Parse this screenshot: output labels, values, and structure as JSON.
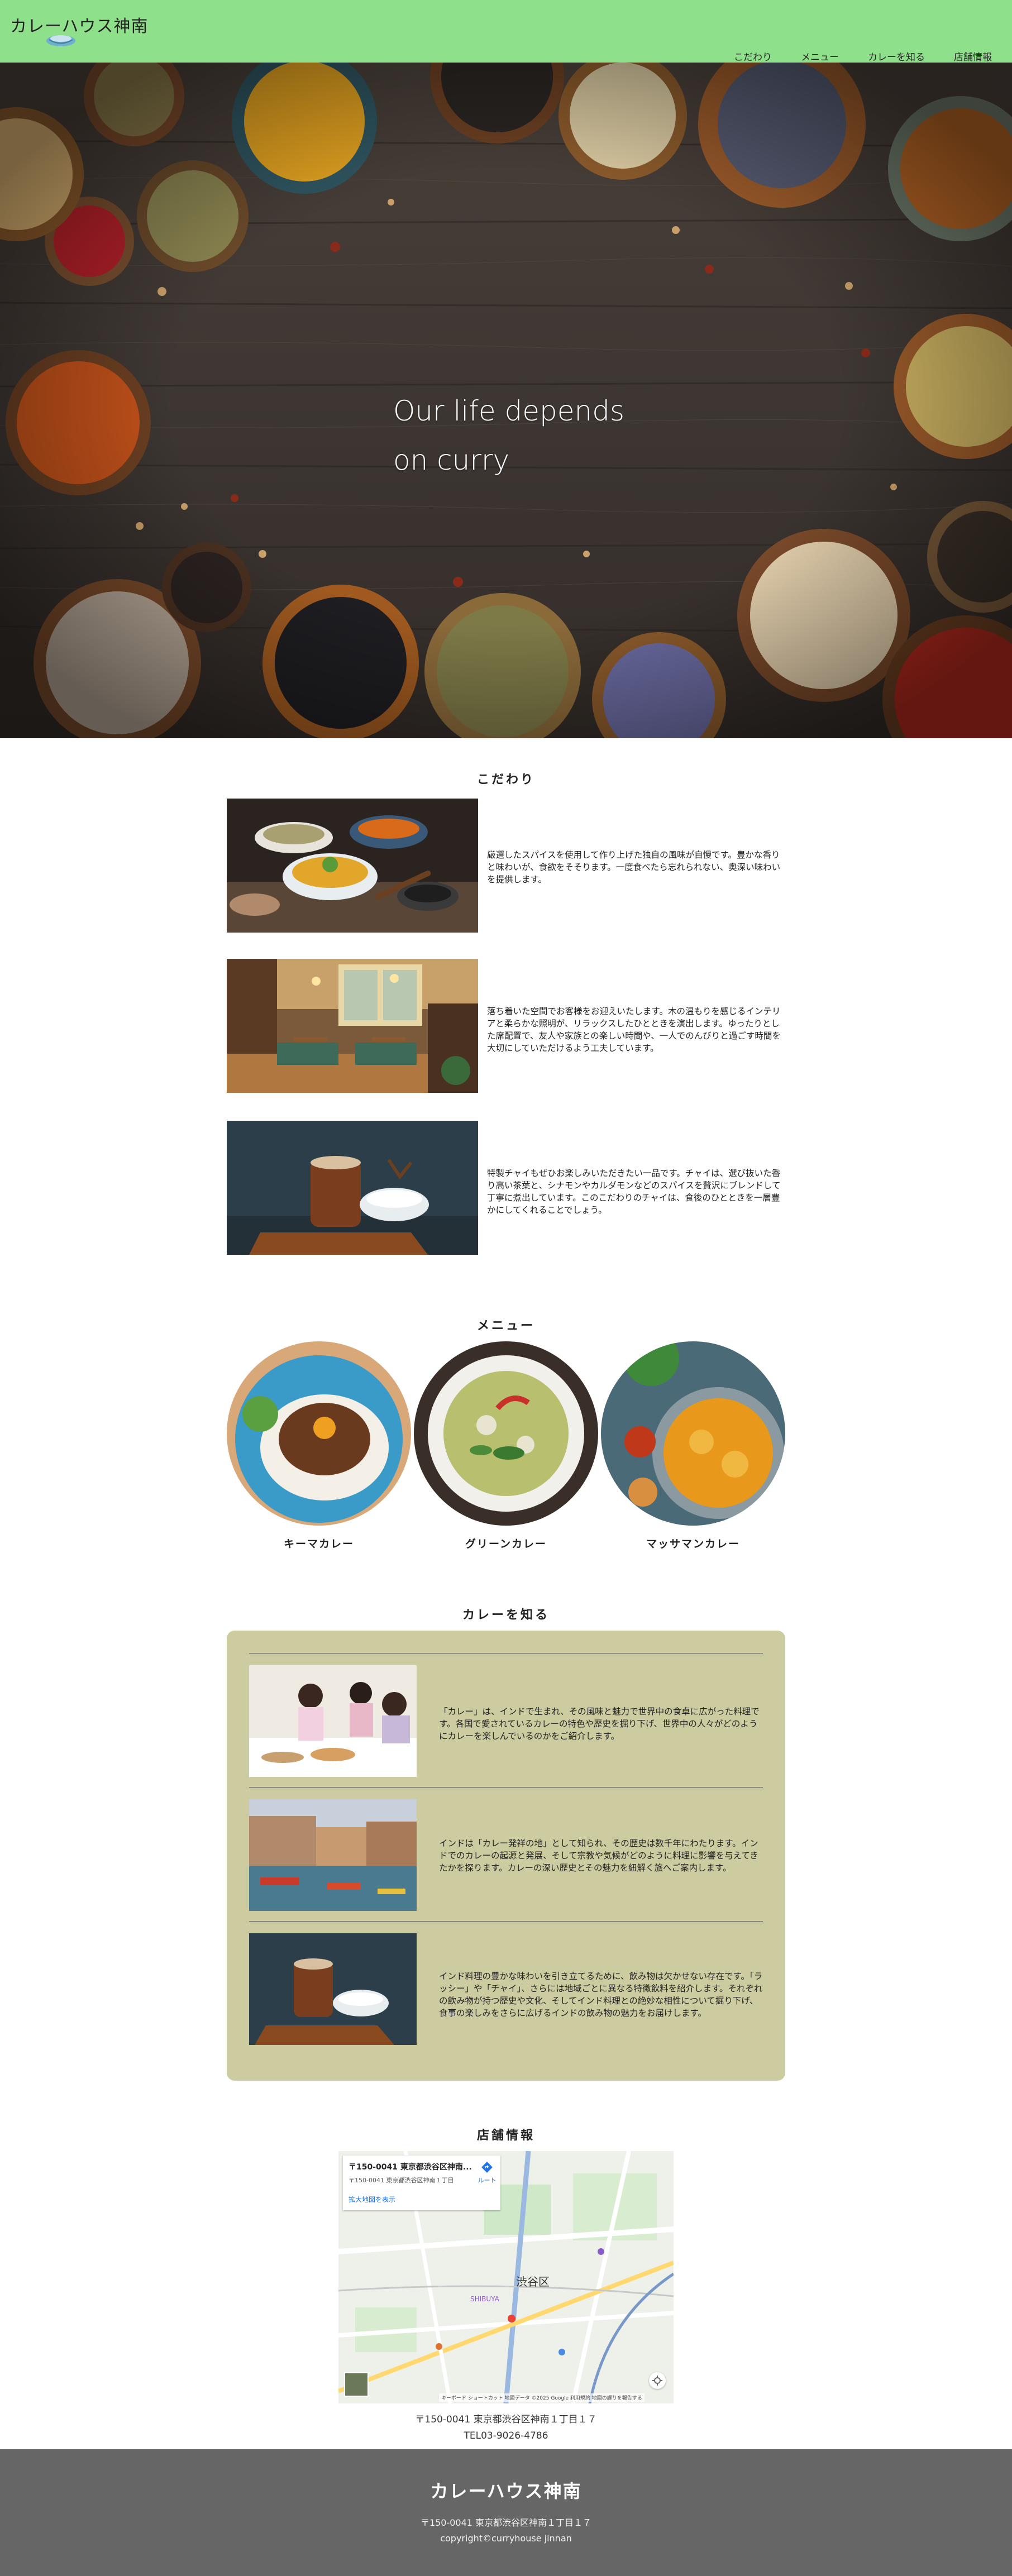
{
  "header": {
    "logo_text": "カレーハウス神南",
    "nav": [
      "こだわり",
      "メニュー",
      "カレーを知る",
      "店舗情報"
    ]
  },
  "hero": {
    "line1": "Our life depends",
    "line2": "on curry"
  },
  "kodawari": {
    "title": "こだわり",
    "items": [
      {
        "text": "厳選したスパイスを使用して作り上げた独自の風味が自慢です。豊かな香りと味わいが、食欲をそそります。一度食べたら忘れられない、奥深い味わいを提供します。"
      },
      {
        "text": "落ち着いた空間でお客様をお迎えいたします。木の温もりを感じるインテリアと柔らかな照明が、リラックスしたひとときを演出します。ゆったりとした席配置で、友人や家族との楽しい時間や、一人でのんびりと過ごす時間を大切にしていただけるよう工夫しています。"
      },
      {
        "text": "特製チャイもぜひお楽しみいただきたい一品です。チャイは、選び抜いた香り高い茶葉と、シナモンやカルダモンなどのスパイスを贅沢にブレンドして丁寧に煮出しています。このこだわりのチャイは、食後のひとときを一層豊かにしてくれることでしょう。"
      }
    ]
  },
  "menu": {
    "title": "メニュー",
    "items": [
      {
        "label": "キーマカレー"
      },
      {
        "label": "グリーンカレー"
      },
      {
        "label": "マッサマンカレー"
      }
    ]
  },
  "know": {
    "title": "カレーを知る",
    "items": [
      {
        "text": "「カレー」は、インドで生まれ、その風味と魅力で世界中の食卓に広がった料理です。各国で愛されているカレーの特色や歴史を掘り下げ、世界中の人々がどのようにカレーを楽しんでいるのかをご紹介します。"
      },
      {
        "text": "インドは「カレー発祥の地」として知られ、その歴史は数千年にわたります。インドでのカレーの起源と発展、そして宗教や気候がどのように料理に影響を与えてきたかを探ります。カレーの深い歴史とその魅力を紐解く旅へご案内します。"
      },
      {
        "text": "インド料理の豊かな味わいを引き立てるために、飲み物は欠かせない存在です。「ラッシー」や「チャイ」、さらには地域ごとに異なる特徴飲料を紹介します。それぞれの飲み物が持つ歴史や文化、そしてインド料理との絶妙な相性について掘り下げ、食事の楽しみをさらに広げるインドの飲み物の魅力をお届けします。"
      }
    ]
  },
  "store": {
    "title": "店舗情報",
    "map": {
      "card_title": "〒150-0041 東京都渋谷区神南...",
      "card_address": "〒150-0041 東京都渋谷区神南１丁目",
      "card_link": "拡大地図を表示",
      "route_label": "ルート",
      "district_label": "渋谷区",
      "area_label": "SHIBUYA",
      "attribution": "キーボード ショートカット  地図データ ©2025 Google  利用規約  地図の誤りを報告する"
    },
    "address": "〒150-0041 東京都渋谷区神南１丁目１７",
    "tel": "TEL03-9026-4786"
  },
  "footer": {
    "title": "カレーハウス神南",
    "address": "〒150-0041 東京都渋谷区神南１丁目１７",
    "copyright": "copyright©curryhouse jinnan"
  },
  "colors": {
    "header_bg": "#8fe08a",
    "panel_bg": "#cccca0",
    "footer_bg": "#666666"
  }
}
